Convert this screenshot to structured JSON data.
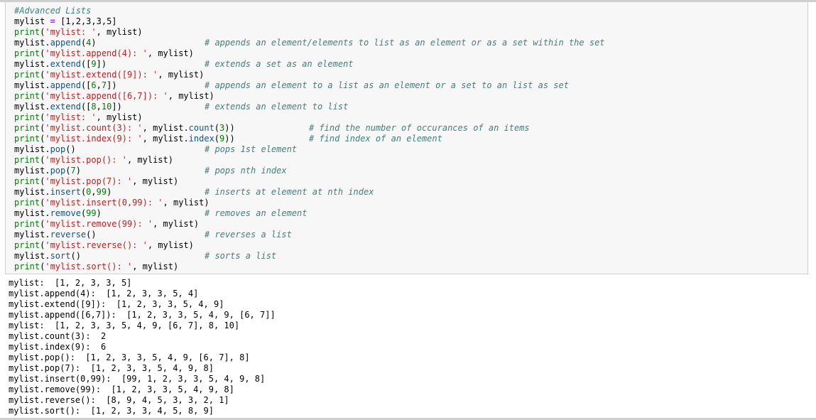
{
  "code_cell": {
    "header_comment": "#Advanced Lists",
    "lines": {
      "l2": {
        "var": "mylist",
        "op": "=",
        "value": "[1,2,3,3,5]"
      },
      "l3": {
        "kw": "print",
        "open": "(",
        "str": "'mylist: '",
        "rest": ", mylist)"
      },
      "l4": {
        "obj": "mylist.",
        "method": "append",
        "open": "(",
        "arg": "4",
        "close": ")",
        "comment": "# appends an element/elements to list as an element or as a set within the set"
      },
      "l5": {
        "kw": "print",
        "open": "(",
        "str": "'mylist.append(4): '",
        "rest": ", mylist)"
      },
      "l6": {
        "obj": "mylist.",
        "method": "extend",
        "open": "([",
        "arg": "9",
        "close": "])",
        "comment": "# extends a set as an element"
      },
      "l7": {
        "kw": "print",
        "open": "(",
        "str": "'mylist.extend([9]): '",
        "rest": ", mylist)"
      },
      "l8": {
        "obj": "mylist.",
        "method": "append",
        "open": "([",
        "arg1": "6",
        "sep": ",",
        "arg2": "7",
        "close": "])",
        "comment": "# appends an element to a list as an element or a set to an list as set"
      },
      "l9": {
        "kw": "print",
        "open": "(",
        "str": "'mylist.append([6,7]): '",
        "rest": ", mylist)"
      },
      "l10": {
        "obj": "mylist.",
        "method": "extend",
        "open": "([",
        "arg1": "8",
        "sep": ",",
        "arg2": "10",
        "close": "])",
        "comment": "# extends an element to list"
      },
      "l11": {
        "kw": "print",
        "open": "(",
        "str": "'mylist: '",
        "rest": ", mylist)"
      },
      "l12": {
        "kw": "print",
        "open": "(",
        "str": "'mylist.count(3): '",
        "mid": ", mylist.",
        "method": "count",
        "open2": "(",
        "arg": "3",
        "close": "))",
        "comment": "# find the number of occurances of an items"
      },
      "l13": {
        "kw": "print",
        "open": "(",
        "str": "'mylist.index(9): '",
        "mid": ", mylist.",
        "method": "index",
        "open2": "(",
        "arg": "9",
        "close": "))",
        "comment": "# find index of an element"
      },
      "l14": {
        "obj": "mylist.",
        "method": "pop",
        "call": "()",
        "comment": "# pops 1st element"
      },
      "l15": {
        "kw": "print",
        "open": "(",
        "str": "'mylist.pop(): '",
        "rest": ", mylist)"
      },
      "l16": {
        "obj": "mylist.",
        "method": "pop",
        "open": "(",
        "arg": "7",
        "close": ")",
        "comment": "# pops nth index"
      },
      "l17": {
        "kw": "print",
        "open": "(",
        "str": "'mylist.pop(7): '",
        "rest": ", mylist)"
      },
      "l18": {
        "obj": "mylist.",
        "method": "insert",
        "open": "(",
        "arg1": "0",
        "sep": ",",
        "arg2": "99",
        "close": ")",
        "comment": "# inserts at element at nth index"
      },
      "l19": {
        "kw": "print",
        "open": "(",
        "str": "'mylist.insert(0,99): '",
        "rest": ", mylist)"
      },
      "l20": {
        "obj": "mylist.",
        "method": "remove",
        "open": "(",
        "arg": "99",
        "close": ")",
        "comment": "# removes an element"
      },
      "l21": {
        "kw": "print",
        "open": "(",
        "str": "'mylist.remove(99): '",
        "rest": ", mylist)"
      },
      "l22": {
        "obj": "mylist.",
        "method": "reverse",
        "call": "()",
        "comment": "# reverses a list"
      },
      "l23": {
        "kw": "print",
        "open": "(",
        "str": "'mylist.reverse(): '",
        "rest": ", mylist)"
      },
      "l24": {
        "obj": "mylist.",
        "method": "sort",
        "call": "()",
        "comment": "# sorts a list"
      },
      "l25": {
        "kw": "print",
        "open": "(",
        "str": "'mylist.sort(): '",
        "rest": ", mylist)"
      }
    }
  },
  "output_cell": {
    "lines": [
      "mylist:  [1, 2, 3, 3, 5]",
      "mylist.append(4):  [1, 2, 3, 3, 5, 4]",
      "mylist.extend([9]):  [1, 2, 3, 3, 5, 4, 9]",
      "mylist.append([6,7]):  [1, 2, 3, 3, 5, 4, 9, [6, 7]]",
      "mylist:  [1, 2, 3, 3, 5, 4, 9, [6, 7], 8, 10]",
      "mylist.count(3):  2",
      "mylist.index(9):  6",
      "mylist.pop():  [1, 2, 3, 3, 5, 4, 9, [6, 7], 8]",
      "mylist.pop(7):  [1, 2, 3, 3, 5, 4, 9, 8]",
      "mylist.insert(0,99):  [99, 1, 2, 3, 3, 5, 4, 9, 8]",
      "mylist.remove(99):  [1, 2, 3, 3, 5, 4, 9, 8]",
      "mylist.reverse():  [8, 9, 4, 5, 3, 3, 2, 1]",
      "mylist.sort():  [1, 2, 3, 3, 4, 5, 8, 9]"
    ]
  },
  "colors": {
    "keyword": "#008000",
    "string": "#ba2121",
    "number": "#008000",
    "method": "#0b5394",
    "comment": "#408080",
    "operator": "#aa22ff",
    "input_background": "#f7f7f7",
    "border": "#cfcfcf"
  }
}
